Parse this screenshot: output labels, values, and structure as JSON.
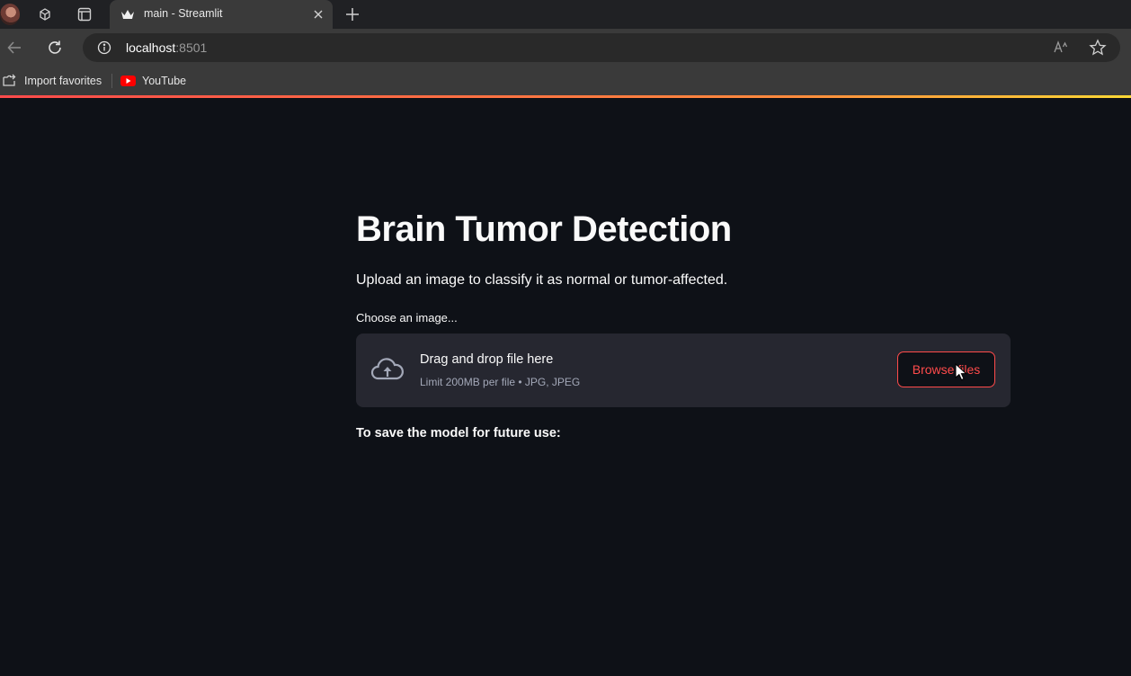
{
  "browser": {
    "tab_title": "main - Streamlit",
    "url_host": "localhost",
    "url_port": ":8501",
    "favorites": [
      {
        "label": "Import favorites",
        "icon": "import-favorites-icon"
      },
      {
        "label": "YouTube",
        "icon": "youtube-icon"
      }
    ]
  },
  "page": {
    "title": "Brain Tumor Detection",
    "subtitle": "Upload an image to classify it as normal or tumor-affected.",
    "uploader": {
      "label": "Choose an image...",
      "drop_text": "Drag and drop file here",
      "limit_text": "Limit 200MB per file • JPG, JPEG",
      "button_label": "Browse files",
      "icon": "cloud-upload-icon"
    },
    "save_note": "To save the model for future use:"
  },
  "colors": {
    "background": "#0e1117",
    "accent": "#ff4b4b",
    "dropzone": "#262730"
  }
}
